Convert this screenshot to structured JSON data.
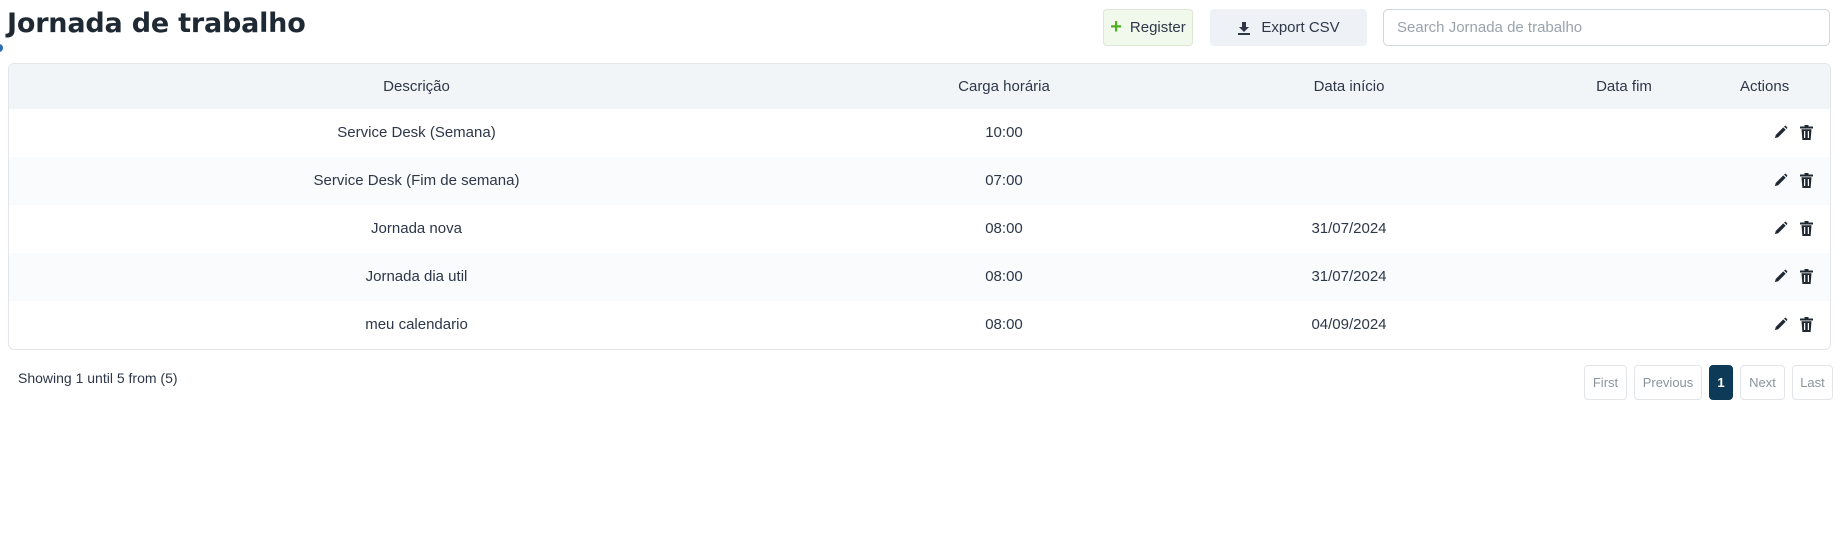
{
  "header": {
    "title": "Jornada de trabalho",
    "register_label": "Register",
    "export_label": "Export CSV",
    "search_placeholder": "Search Jornada de trabalho"
  },
  "colors": {
    "accent_green": "#4caf1f",
    "pagination_active": "#0d3a57",
    "header_row_bg": "#f2f5f8"
  },
  "icons": {
    "register": "plus-icon",
    "export": "download-icon",
    "edit": "pencil-icon",
    "delete": "trash-icon"
  },
  "table": {
    "columns": [
      "Descrição",
      "Carga horária",
      "Data início",
      "Data fim",
      "Actions"
    ],
    "rows": [
      {
        "descricao": "Service Desk (Semana)",
        "carga": "10:00",
        "inicio": "",
        "fim": ""
      },
      {
        "descricao": "Service Desk (Fim de semana)",
        "carga": "07:00",
        "inicio": "",
        "fim": ""
      },
      {
        "descricao": "Jornada nova",
        "carga": "08:00",
        "inicio": "31/07/2024",
        "fim": ""
      },
      {
        "descricao": "Jornada dia util",
        "carga": "08:00",
        "inicio": "31/07/2024",
        "fim": ""
      },
      {
        "descricao": "meu calendario",
        "carga": "08:00",
        "inicio": "04/09/2024",
        "fim": ""
      }
    ]
  },
  "footer": {
    "showing_text": "Showing 1 until 5 from (5)"
  },
  "pagination": {
    "first": "First",
    "previous": "Previous",
    "current": "1",
    "next": "Next",
    "last": "Last"
  }
}
